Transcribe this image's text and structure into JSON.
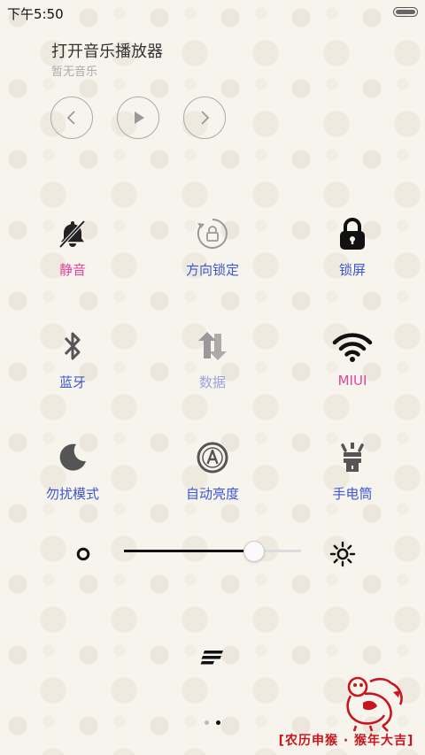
{
  "status": {
    "time": "下午5:50"
  },
  "music": {
    "title": "打开音乐播放器",
    "subtitle": "暂无音乐",
    "prev_icon": "chevron-left-icon",
    "play_icon": "play-icon",
    "next_icon": "chevron-right-icon"
  },
  "toggles": [
    {
      "label": "静音",
      "icon": "bell-muted-icon",
      "color": "#e0459b"
    },
    {
      "label": "方向锁定",
      "icon": "rotation-lock-icon",
      "color": "#3d56cf"
    },
    {
      "label": "锁屏",
      "icon": "padlock-icon",
      "color": "#3d56cf"
    },
    {
      "label": "蓝牙",
      "icon": "bluetooth-icon",
      "color": "#3d56cf"
    },
    {
      "label": "数据",
      "icon": "data-arrows-icon",
      "color": "#9aa3e0"
    },
    {
      "label": "MIUI",
      "icon": "wifi-icon",
      "color": "#e0459b"
    },
    {
      "label": "勿扰模式",
      "icon": "moon-icon",
      "color": "#3d56cf"
    },
    {
      "label": "自动亮度",
      "icon": "auto-brightness-icon",
      "color": "#3d56cf"
    },
    {
      "label": "手电筒",
      "icon": "flashlight-icon",
      "color": "#3d56cf"
    }
  ],
  "brightness": {
    "value_fraction": 0.73
  },
  "pager": {
    "total": 2,
    "current": 2
  },
  "banner": {
    "text": "[农历申猴 · 猴年大吉]"
  },
  "colors": {
    "accent_pink": "#e0459b",
    "accent_blue": "#3d56cf",
    "faded_blue": "#9aa3e0"
  }
}
